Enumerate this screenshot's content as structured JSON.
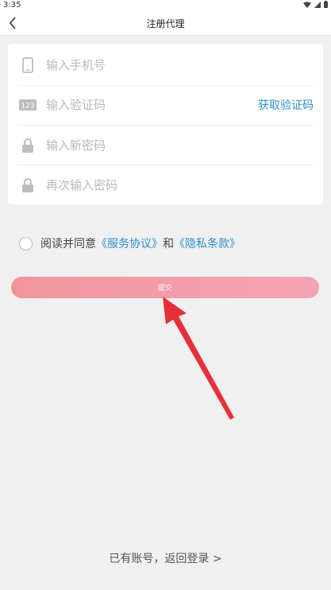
{
  "status_bar": {
    "time": "3:35",
    "wifi_icon": "wifi-icon",
    "signal_icon": "signal-icon",
    "battery_icon": "battery-icon"
  },
  "nav": {
    "title": "注册代理",
    "back_icon": "back-arrow-icon"
  },
  "form": {
    "phone": {
      "placeholder": "输入手机号",
      "value": "",
      "icon": "phone-icon"
    },
    "code": {
      "placeholder": "输入验证码",
      "value": "",
      "icon": "keypad-123-icon",
      "get_code_label": "获取验证码"
    },
    "new_password": {
      "placeholder": "输入新密码",
      "value": "",
      "icon": "lock-icon"
    },
    "confirm_password": {
      "placeholder": "再次输入密码",
      "value": "",
      "icon": "lock-icon"
    }
  },
  "agreement": {
    "checked": false,
    "prefix": "阅读并同意",
    "service_link": "《服务协议》",
    "conjunction": "和",
    "privacy_link": "《隐私条款》"
  },
  "submit": {
    "label": "提交"
  },
  "footer": {
    "login_link": "已有账号，返回登录 >"
  },
  "colors": {
    "accent_blue": "#2f8fd0",
    "button_gradient_start": "#f2949c",
    "button_gradient_end": "#f5a3b4",
    "annotation_arrow": "#e8303a",
    "background": "#f0f0f0"
  }
}
